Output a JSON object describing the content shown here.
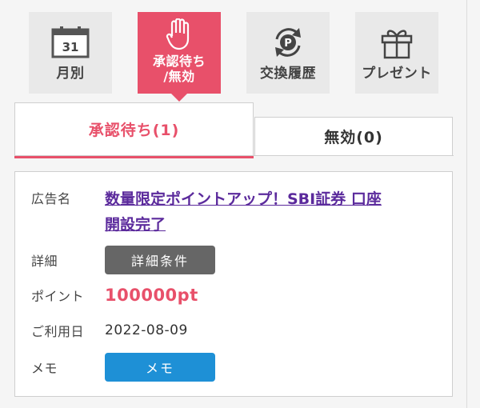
{
  "nav": [
    {
      "label": "月別",
      "icon": "calendar-icon",
      "calendar_day": "31"
    },
    {
      "label": "承認待ち\n/無効",
      "icon": "raised-hand-icon"
    },
    {
      "label": "交換履歴",
      "icon": "point-exchange-icon"
    },
    {
      "label": "プレゼント",
      "icon": "gift-icon"
    }
  ],
  "tabs": {
    "active": "承認待ち(1)",
    "inactive": "無効(0)"
  },
  "record": {
    "ad_label": "広告名",
    "ad_title_line1": "数量限定ポイントアップ！SBI証券 口座",
    "ad_title_line2": "開設完了",
    "detail_label": "詳細",
    "detail_button": "詳細条件",
    "points_label": "ポイント",
    "points_value": "100000pt",
    "date_label": "ご利用日",
    "date_value": "2022-08-09",
    "memo_label": "メモ",
    "memo_button": "メモ"
  },
  "colors": {
    "accent": "#e8506a",
    "link": "#5b2a9c",
    "memo_button": "#1e90d6",
    "detail_button": "#666666"
  }
}
